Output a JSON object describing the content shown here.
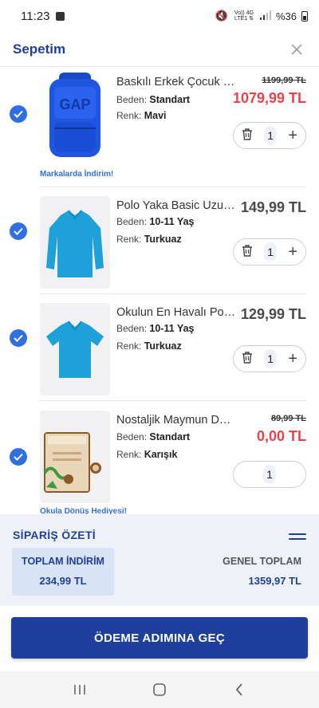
{
  "status_bar": {
    "time": "11:23",
    "network": "Vo)) 4G LTE1",
    "battery": "%36"
  },
  "header": {
    "title": "Sepetim"
  },
  "items": [
    {
      "name": "Baskılı Erkek Çocuk Sırt Çantası",
      "size_label": "Beden:",
      "size": "Standart",
      "color_label": "Renk:",
      "color": "Mavi",
      "old_price": "1199,99 TL",
      "price": "1079,99 TL",
      "qty": "1",
      "promo": "Markalarda İndirim!"
    },
    {
      "name": "Polo Yaka Basic Uzun Kollu",
      "size_label": "Beden:",
      "size": "10-11 Yaş",
      "color_label": "Renk:",
      "color": "Turkuaz",
      "price": "149,99 TL",
      "qty": "1"
    },
    {
      "name": "Okulun En Havalı Polo Yaka",
      "size_label": "Beden:",
      "size": "10-11 Yaş",
      "color_label": "Renk:",
      "color": "Turkuaz",
      "price": "129,99 TL",
      "qty": "1"
    },
    {
      "name": "Nostaljik Maymun Desenli",
      "size_label": "Beden:",
      "size": "Standart",
      "color_label": "Renk:",
      "color": "Karışık",
      "old_price": "89,99 TL",
      "price": "0,00 TL",
      "qty": "1",
      "promo": "Okula Dönüş Hediyesi!"
    }
  ],
  "summary": {
    "title": "SİPARİŞ ÖZETİ",
    "discount_label": "TOPLAM İNDİRİM",
    "discount_value": "234,99 TL",
    "total_label": "GENEL TOPLAM",
    "total_value": "1359,97 TL"
  },
  "checkout": {
    "label": "ÖDEME ADIMINA GEÇ"
  },
  "colors": {
    "brand": "#1e3f9c",
    "accent": "#2f6fe0",
    "price_red": "#e8424b"
  }
}
